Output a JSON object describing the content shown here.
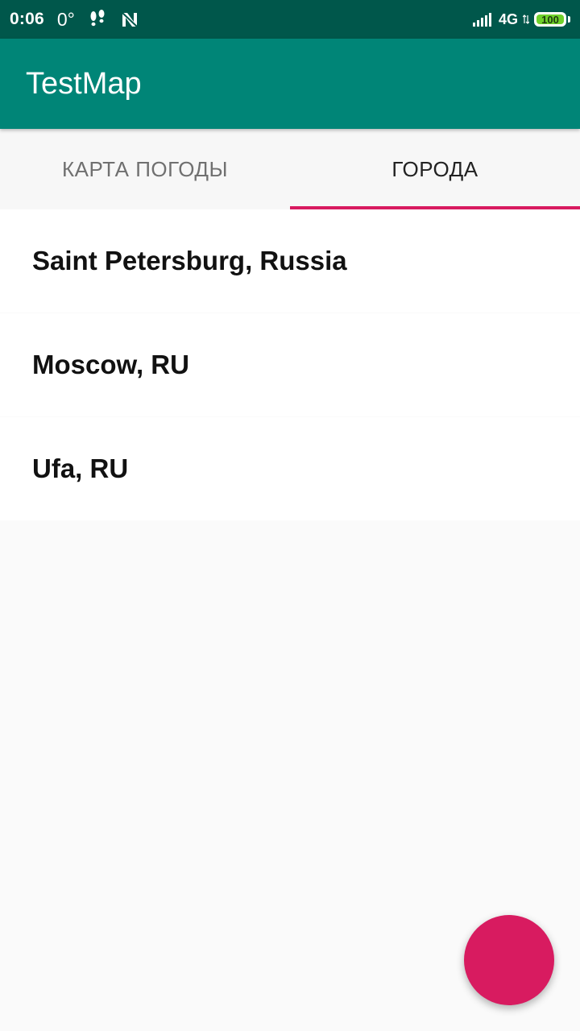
{
  "status_bar": {
    "time": "0:06",
    "temperature": "0°",
    "network": "4G",
    "battery": "100",
    "battery_color": "#6fd12b",
    "icons": [
      "footprints-icon",
      "n-logo-icon",
      "signal-icon",
      "battery-icon"
    ]
  },
  "app_bar": {
    "title": "TestMap",
    "color": "#008577"
  },
  "tabs": [
    {
      "label": "КАРТА ПОГОДЫ",
      "selected": false
    },
    {
      "label": "ГОРОДА",
      "selected": true
    }
  ],
  "cities": [
    {
      "name": "Saint Petersburg, Russia"
    },
    {
      "name": "Moscow, RU"
    },
    {
      "name": "Ufa, RU"
    }
  ],
  "fab": {
    "color": "#d81b60"
  }
}
